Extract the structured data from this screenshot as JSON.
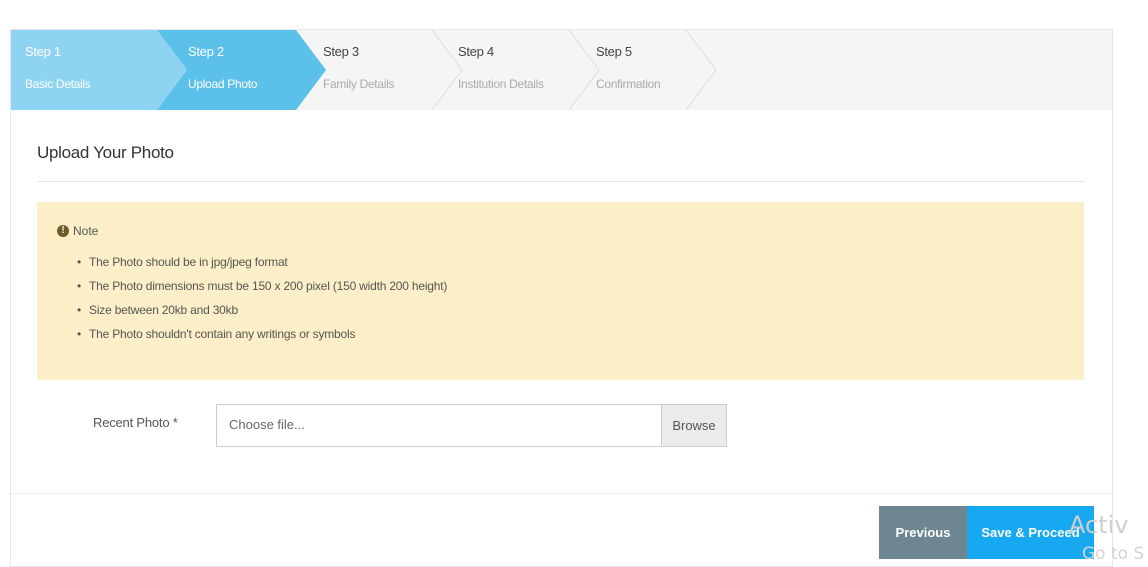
{
  "stepper": {
    "steps": [
      {
        "title": "Step 1",
        "subtitle": "Basic Details"
      },
      {
        "title": "Step 2",
        "subtitle": "Upload Photo"
      },
      {
        "title": "Step 3",
        "subtitle": "Family Details"
      },
      {
        "title": "Step 4",
        "subtitle": "Institution Details"
      },
      {
        "title": "Step 5",
        "subtitle": "Confirmation"
      }
    ],
    "colors": {
      "done": "#8fd3f2",
      "active": "#5bc0ea",
      "inactive": "#f5f5f5"
    }
  },
  "section_title": "Upload Your Photo",
  "note": {
    "heading": "Note",
    "items": [
      "The Photo should be in jpg/jpeg format",
      "The Photo dimensions must be 150 x 200 pixel (150 width 200 height)",
      "Size between 20kb and 30kb",
      "The Photo shouldn't contain any writings or symbols"
    ],
    "background": "#fcefc7"
  },
  "upload": {
    "label": "Recent Photo *",
    "placeholder": "Choose file...",
    "browse_label": "Browse"
  },
  "actions": {
    "previous_label": "Previous",
    "save_label": "Save & Proceed"
  },
  "watermark": {
    "line1": "Activ",
    "line2": "Go to S"
  }
}
